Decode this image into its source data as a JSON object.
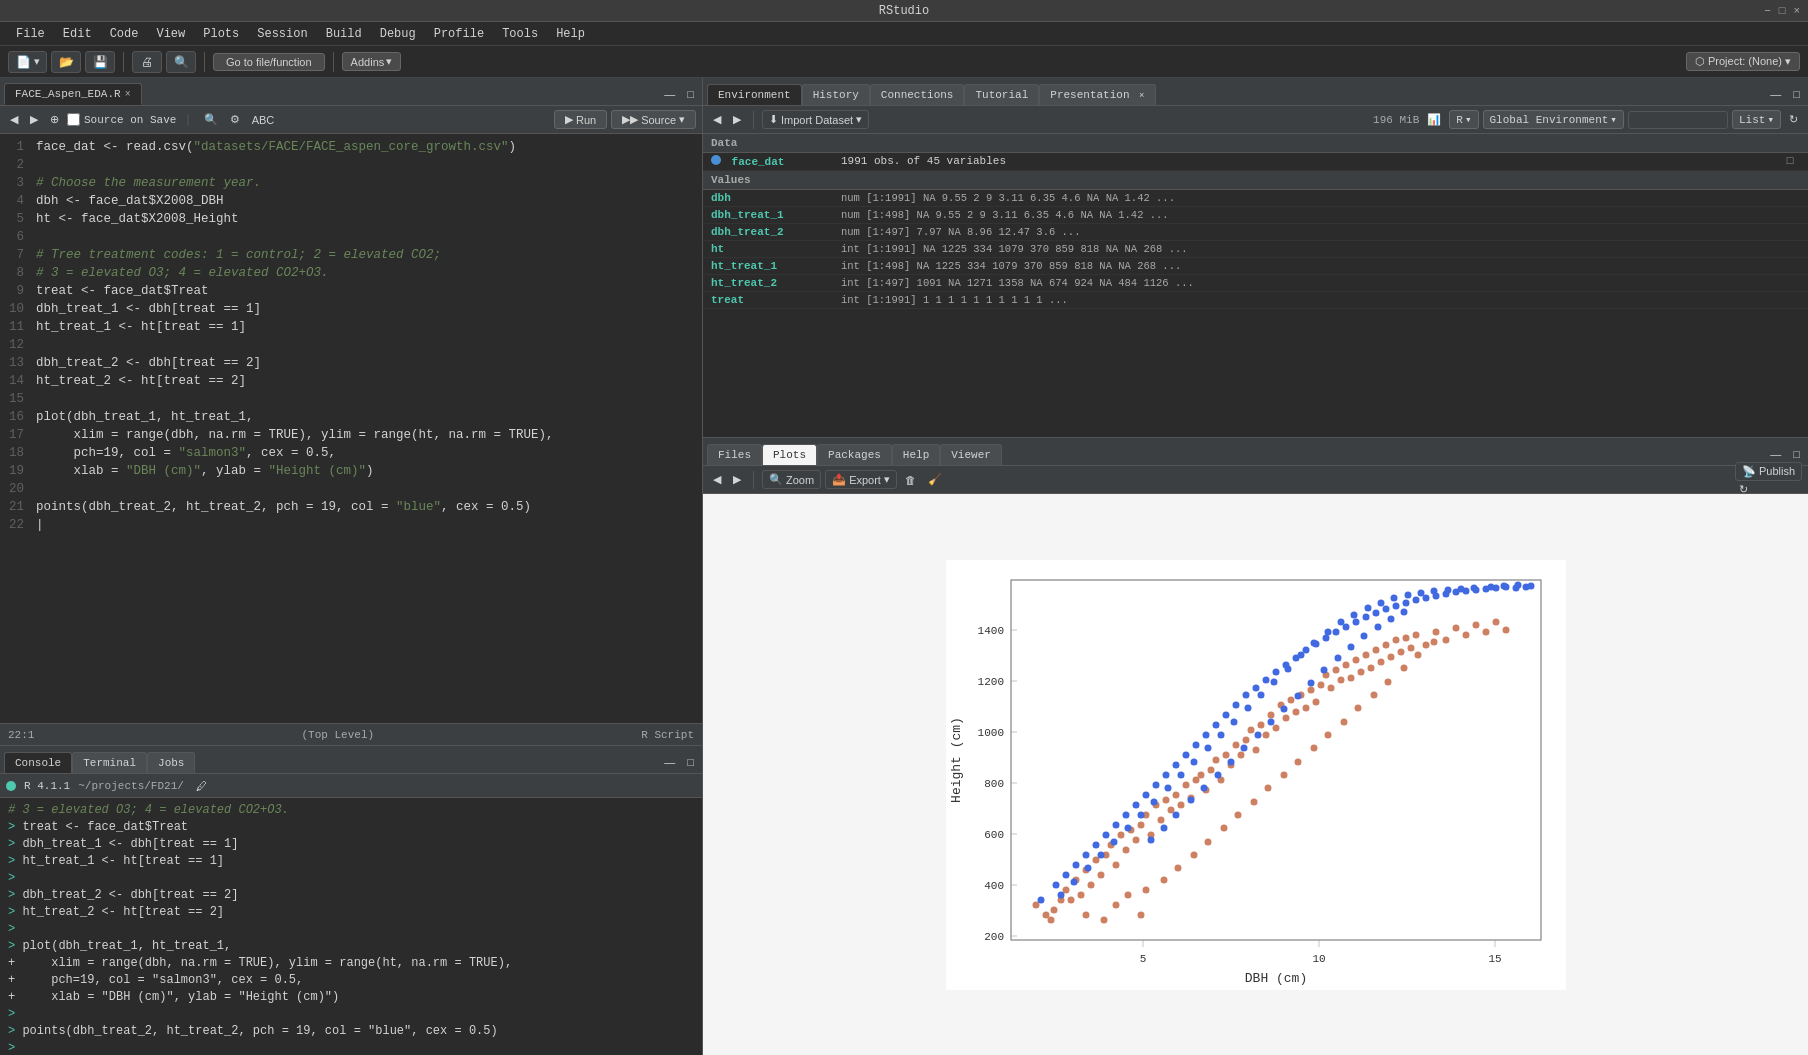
{
  "titlebar": {
    "title": "RStudio",
    "controls": [
      "−",
      "□",
      "×"
    ]
  },
  "menubar": {
    "items": [
      "File",
      "Edit",
      "Code",
      "View",
      "Plots",
      "Session",
      "Build",
      "Debug",
      "Profile",
      "Tools",
      "Help"
    ]
  },
  "toolbar": {
    "project_label": "Project: (None)",
    "addins_label": "Addins",
    "go_to_file_label": "Go to file/function"
  },
  "editor": {
    "tab_label": "FACE_Aspen_EDA.R",
    "source_on_save": "Source on Save",
    "run_label": "Run",
    "source_label": "Source",
    "status": "22:1",
    "level": "(Top Level)",
    "script_type": "R Script",
    "lines": [
      {
        "num": 1,
        "content": "face_dat <- read.csv(\"datasets/FACE/FACE_aspen_core_growth.csv\")",
        "type": "code"
      },
      {
        "num": 2,
        "content": "",
        "type": "blank"
      },
      {
        "num": 3,
        "content": "# Choose the measurement year.",
        "type": "comment"
      },
      {
        "num": 4,
        "content": "dbh <- face_dat$X2008_DBH",
        "type": "code"
      },
      {
        "num": 5,
        "content": "ht <- face_dat$X2008_Height",
        "type": "code"
      },
      {
        "num": 6,
        "content": "",
        "type": "blank"
      },
      {
        "num": 7,
        "content": "# Tree treatment codes: 1 = control; 2 = elevated CO2;",
        "type": "comment"
      },
      {
        "num": 8,
        "content": "# 3 = elevated O3; 4 = elevated CO2+O3.",
        "type": "comment"
      },
      {
        "num": 9,
        "content": "treat <- face_dat$Treat",
        "type": "code"
      },
      {
        "num": 10,
        "content": "dbh_treat_1 <- dbh[treat == 1]",
        "type": "code"
      },
      {
        "num": 11,
        "content": "ht_treat_1 <- ht[treat == 1]",
        "type": "code"
      },
      {
        "num": 12,
        "content": "",
        "type": "blank"
      },
      {
        "num": 13,
        "content": "dbh_treat_2 <- dbh[treat == 2]",
        "type": "code"
      },
      {
        "num": 14,
        "content": "ht_treat_2 <- ht[treat == 2]",
        "type": "code"
      },
      {
        "num": 15,
        "content": "",
        "type": "blank"
      },
      {
        "num": 16,
        "content": "plot(dbh_treat_1, ht_treat_1,",
        "type": "code"
      },
      {
        "num": 17,
        "content": "     xlim = range(dbh, na.rm = TRUE), ylim = range(ht, na.rm = TRUE),",
        "type": "code"
      },
      {
        "num": 18,
        "content": "     pch=19, col = \"salmon3\", cex = 0.5,",
        "type": "code"
      },
      {
        "num": 19,
        "content": "     xlab = \"DBH (cm)\", ylab = \"Height (cm)\")",
        "type": "code"
      },
      {
        "num": 20,
        "content": "",
        "type": "blank"
      },
      {
        "num": 21,
        "content": "points(dbh_treat_2, ht_treat_2, pch = 19, col = \"blue\", cex = 0.5)",
        "type": "code"
      },
      {
        "num": 22,
        "content": "",
        "type": "blank"
      }
    ]
  },
  "console": {
    "tabs": [
      "Console",
      "Terminal",
      "Jobs"
    ],
    "active_tab": "Console",
    "r_version": "R 4.1.1",
    "working_dir": "~/projects/FD21/",
    "lines": [
      {
        "text": "# 3 = elevated O3; 4 = elevated CO2+O3.",
        "type": "comment"
      },
      {
        "text": "> treat <- face_dat$Treat",
        "type": "prompt"
      },
      {
        "text": "> dbh_treat_1 <- dbh[treat == 1]",
        "type": "prompt"
      },
      {
        "text": "> ht_treat_1 <- ht[treat == 1]",
        "type": "prompt"
      },
      {
        "text": ">",
        "type": "prompt"
      },
      {
        "text": "> dbh_treat_2 <- dbh[treat == 2]",
        "type": "prompt"
      },
      {
        "text": "> ht_treat_2 <- ht[treat == 2]",
        "type": "prompt"
      },
      {
        "text": ">",
        "type": "prompt"
      },
      {
        "text": "> plot(dbh_treat_1, ht_treat_1,",
        "type": "prompt"
      },
      {
        "text": "+     xlim = range(dbh, na.rm = TRUE), ylim = range(ht, na.rm = TRUE),",
        "type": "cont"
      },
      {
        "text": "+     pch=19, col = \"salmon3\", cex = 0.5,",
        "type": "cont"
      },
      {
        "text": "+     xlab = \"DBH (cm)\", ylab = \"Height (cm)\")",
        "type": "cont"
      },
      {
        "text": ">",
        "type": "prompt"
      },
      {
        "text": "> points(dbh_treat_2, ht_treat_2, pch = 19, col = \"blue\", cex = 0.5)",
        "type": "prompt"
      },
      {
        "text": ">",
        "type": "prompt"
      }
    ]
  },
  "environment": {
    "tabs": [
      "Environment",
      "History",
      "Connections",
      "Tutorial",
      "Presentation"
    ],
    "active_tab": "Environment",
    "import_dataset_label": "Import Dataset",
    "memory_label": "196 MiB",
    "r_dropdown": "R",
    "global_env": "Global Environment",
    "list_view": "List",
    "data_section": "Data",
    "face_dat": {
      "name": "face_dat",
      "info": "1991 obs. of 45 variables"
    },
    "values_section": "Values",
    "variables": [
      {
        "name": "dbh",
        "value": "num [1:1991] NA 9.55 2 9 3.11 6.35 4.6 NA NA 1.42 ..."
      },
      {
        "name": "dbh_treat_1",
        "value": "num [1:498] NA 9.55 2 9 3.11 6.35 4.6 NA NA 1.42 ..."
      },
      {
        "name": "dbh_treat_2",
        "value": "num [1:497] 7.97 NA 8.96 12.47 3.6 ..."
      },
      {
        "name": "ht",
        "value": "int [1:1991] NA 1225 334 1079 370 859 818 NA NA 268 ..."
      },
      {
        "name": "ht_treat_1",
        "value": "int [1:498] NA 1225 334 1079 370 859 818 NA NA 268 ..."
      },
      {
        "name": "ht_treat_2",
        "value": "int [1:497] 1091 NA 1271 1358 NA 674 924 NA 484 1126 ..."
      },
      {
        "name": "treat",
        "value": "int [1:1991] 1 1 1 1 1 1 1 1 1 1 ..."
      }
    ]
  },
  "plots_panel": {
    "tabs": [
      "Files",
      "Plots",
      "Packages",
      "Help",
      "Viewer"
    ],
    "active_tab": "Plots",
    "zoom_label": "Zoom",
    "export_label": "Export",
    "publish_label": "Publish",
    "plot": {
      "xlab": "DBH (cm)",
      "ylab": "Height (cm)",
      "x_ticks": [
        "5",
        "10",
        "15"
      ],
      "y_ticks": [
        "200",
        "400",
        "600",
        "800",
        "1000",
        "1200",
        "1400"
      ],
      "salmon_color": "#cd8162",
      "blue_color": "#4169e1"
    }
  }
}
